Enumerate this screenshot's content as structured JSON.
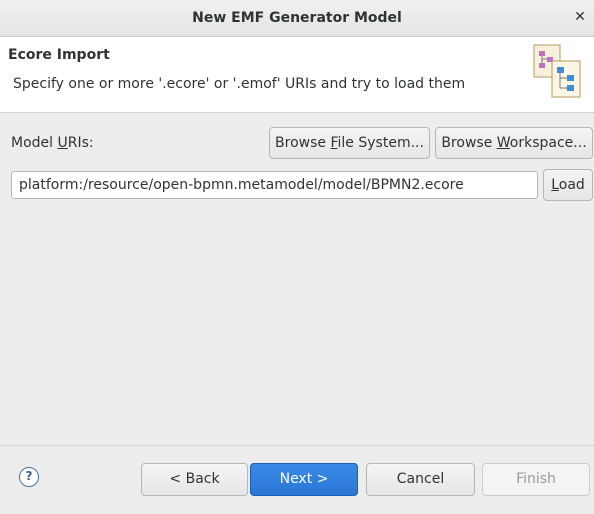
{
  "window": {
    "title": "New EMF Generator Model",
    "close_glyph": "✕"
  },
  "banner": {
    "heading": "Ecore Import",
    "description": "Specify one or more '.ecore' or '.emof' URIs and try to load them",
    "icon": "emf-wizard-icon"
  },
  "form": {
    "model_uris_label_pre": "Model ",
    "model_uris_label_mn": "U",
    "model_uris_label_post": "RIs:",
    "browse_fs_pre": "Browse ",
    "browse_fs_mn": "F",
    "browse_fs_post": "ile System...",
    "browse_ws_pre": "Browse ",
    "browse_ws_mn": "W",
    "browse_ws_post": "orkspace...",
    "uri_value": "platform:/resource/open-bpmn.metamodel/model/BPMN2.ecore",
    "load_mn": "L",
    "load_post": "oad"
  },
  "footer": {
    "help_glyph": "?",
    "back_label": "< Back",
    "next_label": "Next >",
    "cancel_label": "Cancel",
    "finish_label": "Finish"
  },
  "colors": {
    "primary_button": "#2f7fe0",
    "background": "#ededed"
  }
}
